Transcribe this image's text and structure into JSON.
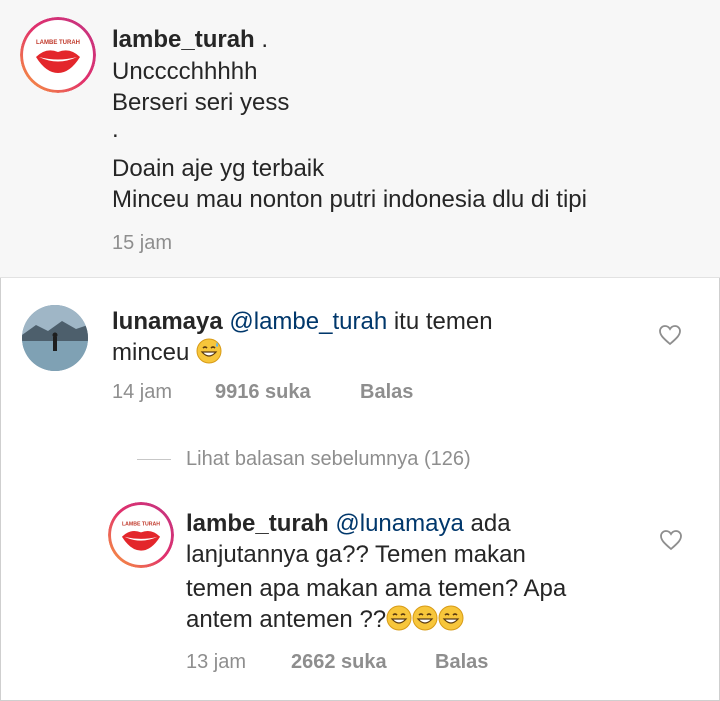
{
  "caption": {
    "username": "lambe_turah",
    "username_suffix": " .",
    "lines": [
      "Uncccchhhhh",
      "Berseri seri yess",
      ".",
      "Doain aje yg terbaik",
      "Minceu mau nonton putri indonesia dlu di tipi"
    ],
    "time": "15 jam"
  },
  "comment1": {
    "username": "lunamaya",
    "mention": "@lambe_turah",
    "text_after_mention": " itu temen",
    "line2": "minceu",
    "emoji": "grinning-sweat-emoji",
    "time": "14 jam",
    "likes": "9916 suka",
    "reply": "Balas"
  },
  "view_previous": "Lihat balasan sebelumnya (126)",
  "reply1": {
    "username": "lambe_turah",
    "mention": "@lunamaya",
    "text_after_mention": " ada",
    "line2": "lanjutannya ga?? Temen makan",
    "line3": "temen apa makan ama temen? Apa",
    "line4": "antem antemen ??",
    "emojis": [
      "grinning-emoji",
      "grinning-emoji",
      "grinning-emoji"
    ],
    "time": "13 jam",
    "likes": "2662 suka",
    "reply": "Balas"
  },
  "logo_text": "LAMBE TURAH",
  "colors": {
    "text": "#262626",
    "meta": "#8e8e8e",
    "mention": "#00376b",
    "lips": "#e3262b"
  }
}
